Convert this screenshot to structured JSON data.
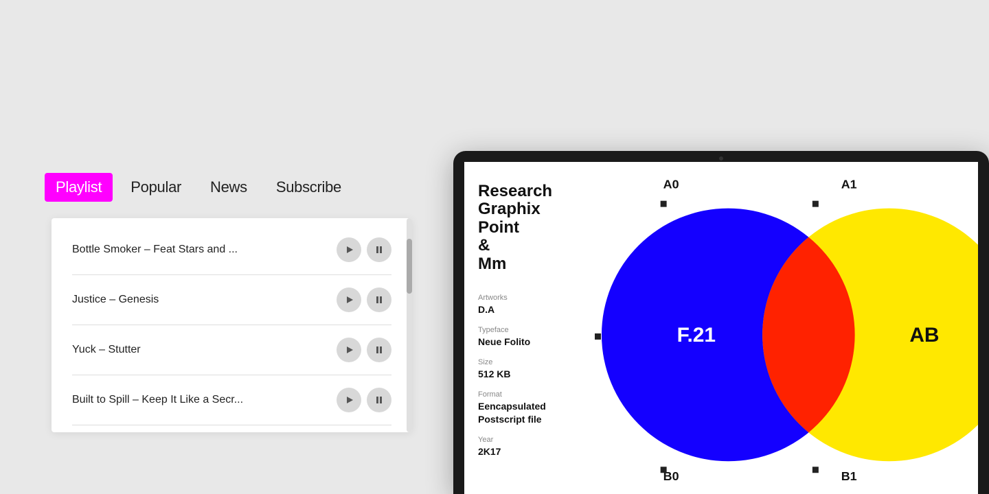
{
  "nav": {
    "tabs": [
      {
        "id": "playlist",
        "label": "Playlist",
        "active": true
      },
      {
        "id": "popular",
        "label": "Popular",
        "active": false
      },
      {
        "id": "news",
        "label": "News",
        "active": false
      },
      {
        "id": "subscribe",
        "label": "Subscribe",
        "active": false
      }
    ]
  },
  "playlist": {
    "tracks": [
      {
        "id": 1,
        "title": "Bottle Smoker –  Feat Stars and ..."
      },
      {
        "id": 2,
        "title": "Justice – Genesis"
      },
      {
        "id": 3,
        "title": "Yuck – Stutter"
      },
      {
        "id": 4,
        "title": "Built to Spill – Keep It Like a Secr..."
      }
    ]
  },
  "tablet": {
    "font_name": "Research\nGraphix\nPoint\n&\nMm",
    "font_name_lines": [
      "Research",
      "Graphix",
      "Point",
      "&",
      "Mm"
    ],
    "artworks_label": "Artworks",
    "artworks_value": "D.A",
    "typeface_label": "Typeface",
    "typeface_value": "Neue Folito",
    "size_label": "Size",
    "size_value": "512 KB",
    "format_label": "Format",
    "format_value": "Eencapsulated\nPostscript file",
    "year_label": "Year",
    "year_value": "2K17",
    "grid_labels": {
      "a0": "A0",
      "a1": "A1",
      "b0": "B0",
      "b1": "B1"
    },
    "center_label": "F.21",
    "ab_label": "AB",
    "circle_blue": {
      "color": "#1400FF",
      "label": "F.21"
    },
    "circle_yellow": {
      "color": "#FFE800"
    },
    "overlap_color": "#FF2200"
  },
  "colors": {
    "accent": "#FF00FF",
    "background": "#e8e8e8"
  }
}
